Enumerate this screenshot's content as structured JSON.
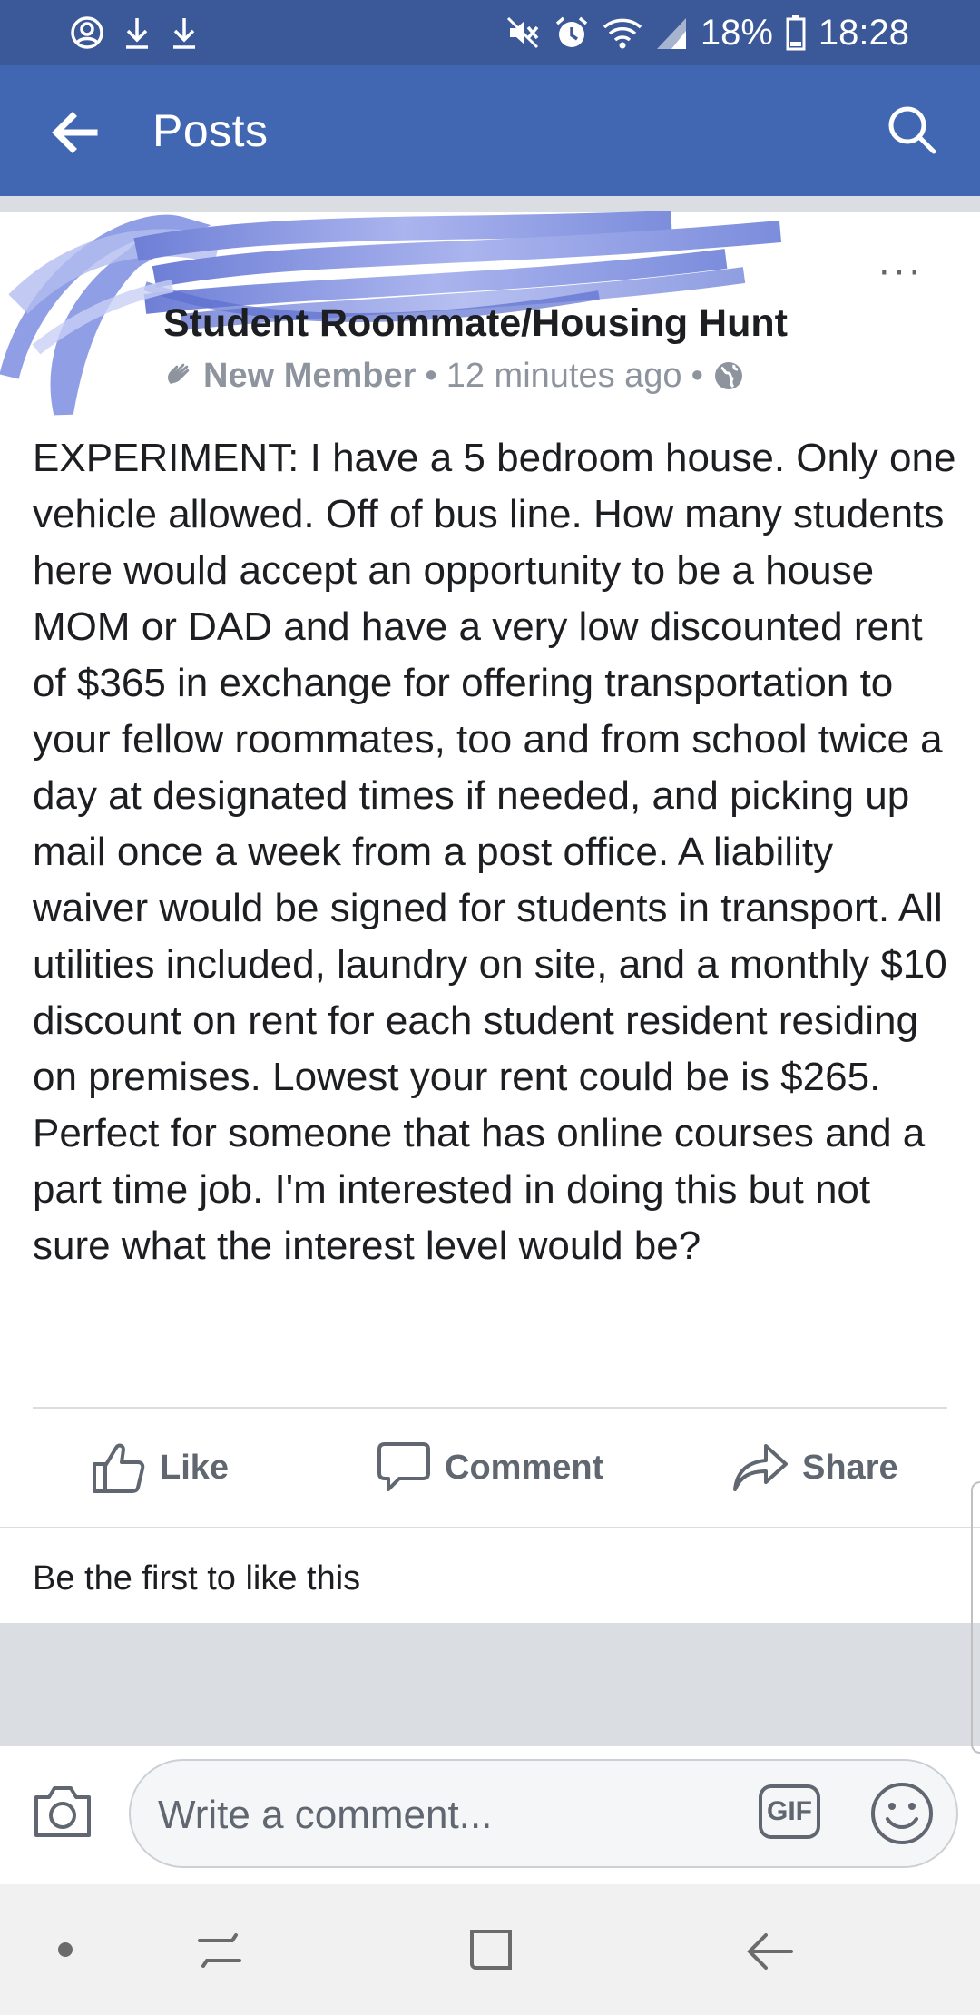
{
  "status_bar": {
    "battery": "18%",
    "time": "18:28",
    "icons": [
      "account-circle-icon",
      "download-icon",
      "download-icon",
      "mute-icon",
      "alarm-icon",
      "wifi-icon",
      "signal-icon",
      "battery-icon"
    ]
  },
  "app_bar": {
    "back_icon": "arrow-left-icon",
    "title": "Posts",
    "search_icon": "search-icon"
  },
  "post": {
    "group_name": "Student Roommate/Housing Hunt",
    "author_badge": "New Member",
    "separator": "•",
    "time": "12 minutes ago",
    "privacy_icon": "globe-icon",
    "more_label": "···",
    "body": "EXPERIMENT: I have a 5 bedroom house. Only one vehicle allowed. Off of bus line. How many students here would accept an opportunity to be a house MOM or DAD and have a very low discounted rent of $365 in exchange for offering transportation to your fellow roommates, too and from school twice a day at designated times if needed, and picking up mail once a week from a post office. A liability waiver would be signed for students in transport. All utilities included, laundry on site, and a monthly $10 discount on rent for each student resident residing on premises. Lowest your rent could be is $265. Perfect for someone that has online courses and a part time job. I'm interested in doing this but not sure what the interest level would be?"
  },
  "actions": {
    "like": "Like",
    "comment": "Comment",
    "share": "Share"
  },
  "reactions": {
    "summary": "Be the first to like this"
  },
  "composer": {
    "placeholder": "Write a comment...",
    "gif_label": "GIF"
  },
  "colors": {
    "status_bar": "#3b5998",
    "app_bar": "#4267b2",
    "secondary_text": "#606770",
    "divider": "#dadde1"
  }
}
